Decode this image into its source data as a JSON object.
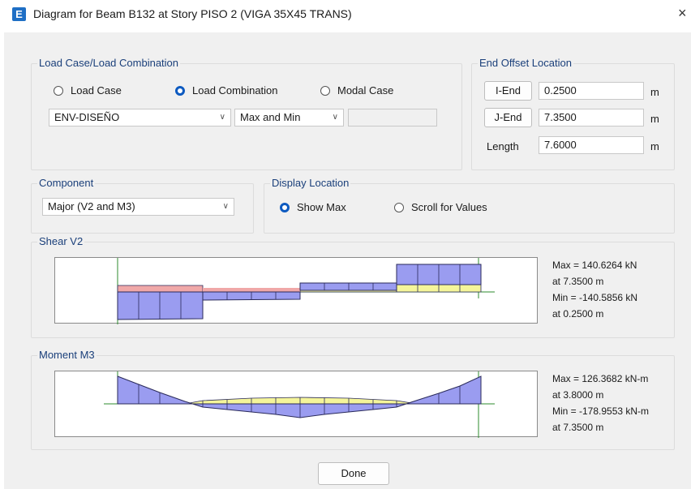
{
  "window": {
    "icon_letter": "E",
    "title": "Diagram for Beam B132 at Story PISO 2 (VIGA 35X45 TRANS)",
    "close_label": "×"
  },
  "load_case": {
    "group_title": "Load Case/Load Combination",
    "radios": [
      {
        "label": "Load Case",
        "selected": false
      },
      {
        "label": "Load Combination",
        "selected": true
      },
      {
        "label": "Modal Case",
        "selected": false
      }
    ],
    "combo_value": "ENV-DISEÑO",
    "mode_value": "Max and Min"
  },
  "end_offset": {
    "group_title": "End Offset Location",
    "i_end_label": "I-End",
    "i_end_value": "0.2500",
    "j_end_label": "J-End",
    "j_end_value": "7.3500",
    "length_label": "Length",
    "length_value": "7.6000",
    "unit": "m"
  },
  "component": {
    "group_title": "Component",
    "value": "Major (V2 and M3)"
  },
  "display_location": {
    "group_title": "Display Location",
    "radios": [
      {
        "label": "Show Max",
        "selected": true
      },
      {
        "label": "Scroll for Values",
        "selected": false
      }
    ]
  },
  "shear": {
    "group_title": "Shear V2",
    "max_line": "Max = 140.6264 kN",
    "max_at": "at 7.3500 m",
    "min_line": "Min = -140.5856 kN",
    "min_at": "at 0.2500 m"
  },
  "moment": {
    "group_title": "Moment M3",
    "max_line": "Max = 126.3682 kN-m",
    "max_at": "at 3.8000 m",
    "min_line": "Min = -178.9553 kN-m",
    "min_at": "at 7.3500 m"
  },
  "done_label": "Done",
  "colors": {
    "accent": "#0d5ac0",
    "diagram_fill": "#9a9cf0",
    "positive_fill": "#f5f59a",
    "negative_fill": "#f0a8a8",
    "axis_green": "#2e8b2e"
  }
}
